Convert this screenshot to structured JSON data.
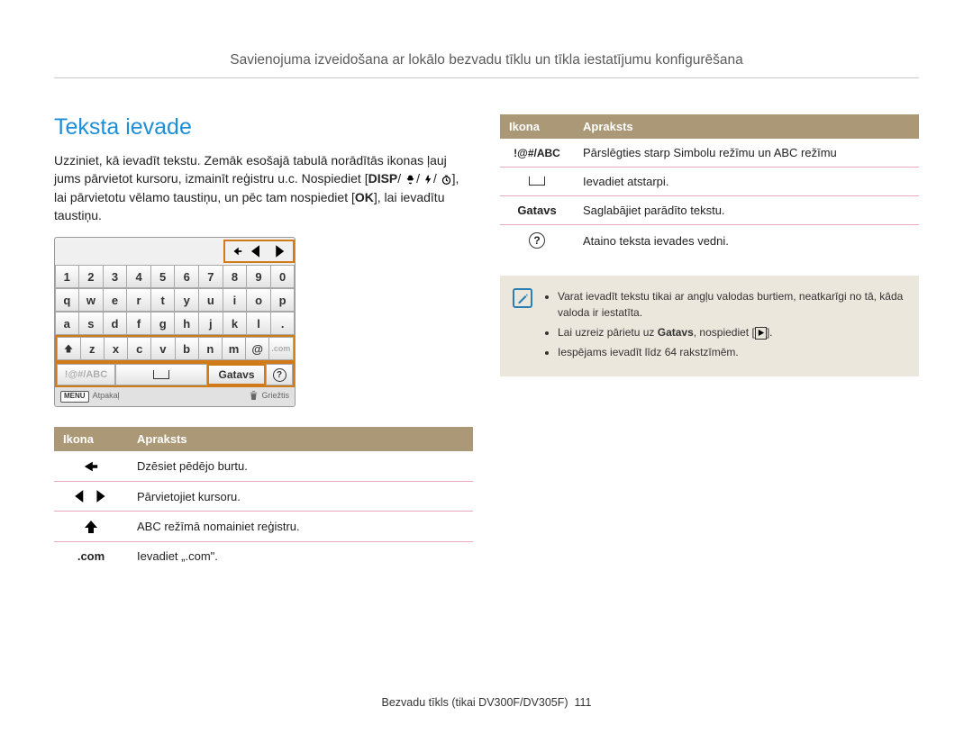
{
  "pageTitle": "Savienojuma izveidošana ar lokālo bezvadu tīklu un tīkla iestatījumu konfigurēšana",
  "sectionHeading": "Teksta ievade",
  "intro": {
    "line1": "Uzziniet, kā ievadīt tekstu. Zemāk esošajā tabulā norādītās ikonas ļauj jums pārvietot kursoru, izmainīt reģistru u.c. Nospiediet",
    "disp": "DISP",
    "line2": "], lai pārvietotu vēlamo taustiņu, un pēc tam nospiediet [",
    "ok": "OK",
    "line3": "], lai ievadītu taustiņu."
  },
  "keyboard": {
    "row1": [
      "1",
      "2",
      "3",
      "4",
      "5",
      "6",
      "7",
      "8",
      "9",
      "0"
    ],
    "row2": [
      "q",
      "w",
      "e",
      "r",
      "t",
      "y",
      "u",
      "i",
      "o",
      "p"
    ],
    "row3": [
      "a",
      "s",
      "d",
      "f",
      "g",
      "h",
      "j",
      "k",
      "l",
      "."
    ],
    "row4": [
      "",
      "z",
      "x",
      "c",
      "v",
      "b",
      "n",
      "m",
      "@",
      ""
    ],
    "done": "Gatavs",
    "footerBack": "Atpakaļ",
    "footerDelete": "Griežtis",
    "menu": "MENU"
  },
  "table1": {
    "headIcon": "Ikona",
    "headDesc": "Apraksts",
    "rows": [
      {
        "icon": "back",
        "desc": "Dzēsiet pēdējo burtu."
      },
      {
        "icon": "lr",
        "desc": "Pārvietojiet kursoru."
      },
      {
        "icon": "shift",
        "desc": "ABC režīmā nomainiet reģistru."
      },
      {
        "icon": ".com",
        "desc": "Ievadiet „.com\"."
      }
    ]
  },
  "table2": {
    "headIcon": "Ikona",
    "headDesc": "Apraksts",
    "rows": [
      {
        "icon": "!@#/ABC",
        "desc": "Pārslēgties starp Simbolu režīmu un ABC režīmu"
      },
      {
        "icon": "space",
        "desc": "Ievadiet atstarpi."
      },
      {
        "icon": "Gatavs",
        "desc": "Saglabājiet parādīto tekstu."
      },
      {
        "icon": "help",
        "desc": "Ataino teksta ievades vedni."
      }
    ]
  },
  "note": {
    "li1": "Varat ievadīt tekstu tikai ar angļu valodas burtiem, neatkarīgi no tā, kāda valoda ir iestatīta.",
    "li2a": "Lai uzreiz pārietu uz ",
    "li2b": "Gatavs",
    "li2c": ", nospiediet [",
    "li2d": "].",
    "li3": "Iespējams ievadīt līdz 64 rakstzīmēm."
  },
  "footer": {
    "text": "Bezvadu tīkls (tikai DV300F/DV305F)",
    "page": "111"
  }
}
